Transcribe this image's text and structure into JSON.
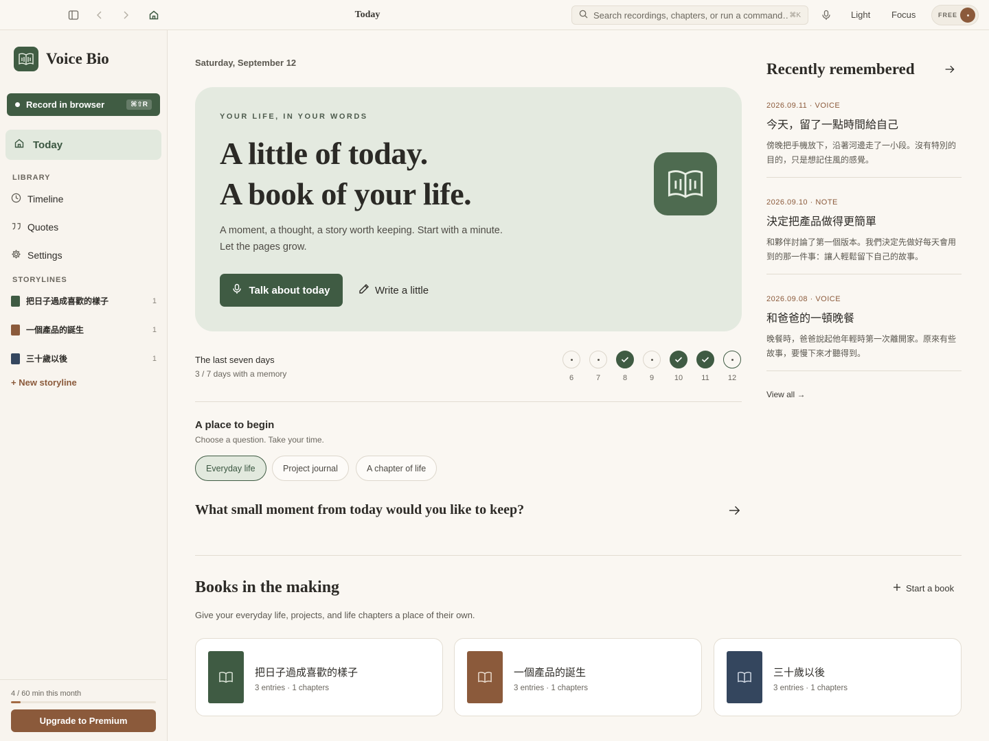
{
  "topbar": {
    "title": "Today",
    "search_placeholder": "Search recordings, chapters, or run a command…",
    "search_shortcut": "⌘K",
    "theme_label": "Light",
    "focus_label": "Focus",
    "plan_label": "FREE"
  },
  "sidebar": {
    "brand": "Voice Bio",
    "record_label": "Record in browser",
    "record_shortcut": "⌘⇧R",
    "today_label": "Today",
    "library_heading": "LIBRARY",
    "library_items": [
      {
        "label": "Timeline",
        "icon": "clock-icon"
      },
      {
        "label": "Quotes",
        "icon": "quote-icon"
      },
      {
        "label": "Settings",
        "icon": "gear-icon"
      }
    ],
    "storylines_heading": "STORYLINES",
    "storylines": [
      {
        "label": "把日子過成喜歡的樣子",
        "count": "1",
        "color": "#3f5b43"
      },
      {
        "label": "一個產品的誕生",
        "count": "1",
        "color": "#8b5a3b"
      },
      {
        "label": "三十歲以後",
        "count": "1",
        "color": "#34465e"
      }
    ],
    "new_storyline_label": "+ New storyline",
    "usage_label": "4 / 60 min this month",
    "usage_fraction": 0.067,
    "upgrade_label": "Upgrade to Premium"
  },
  "main": {
    "date": "Saturday, September 12",
    "hero": {
      "eyebrow": "YOUR LIFE, IN YOUR WORDS",
      "headline_1": "A little of today.",
      "headline_2": "A book of your life.",
      "sub_1": "A moment, a thought, a story worth keeping. Start with a minute.",
      "sub_2": "Let the pages grow.",
      "talk_label": "Talk about today",
      "write_label": "Write a little"
    },
    "week": {
      "title": "The last seven days",
      "summary": "3 / 7 days with a memory",
      "days": [
        {
          "n": "6",
          "state": "empty"
        },
        {
          "n": "7",
          "state": "empty"
        },
        {
          "n": "8",
          "state": "done"
        },
        {
          "n": "9",
          "state": "empty"
        },
        {
          "n": "10",
          "state": "done"
        },
        {
          "n": "11",
          "state": "done"
        },
        {
          "n": "12",
          "state": "today"
        }
      ]
    },
    "begin": {
      "title": "A place to begin",
      "subtitle": "Choose a question. Take your time.",
      "chips": [
        "Everyday life",
        "Project journal",
        "A chapter of life"
      ],
      "selected_chip": "Everyday life",
      "prompt": "What small moment from today would you like to keep?"
    },
    "books": {
      "title": "Books in the making",
      "subtitle": "Give your everyday life, projects, and life chapters a place of their own.",
      "start_label": "Start a book",
      "items": [
        {
          "title": "把日子過成喜歡的樣子",
          "meta": "3 entries · 1 chapters",
          "color": "#3f5b43"
        },
        {
          "title": "一個產品的誕生",
          "meta": "3 entries · 1 chapters",
          "color": "#8b5a3b"
        },
        {
          "title": "三十歲以後",
          "meta": "3 entries · 1 chapters",
          "color": "#34465e"
        }
      ]
    }
  },
  "recent": {
    "title": "Recently remembered",
    "items": [
      {
        "meta": "2026.09.11 · VOICE",
        "title": "今天，留了一點時間給自己",
        "body_1": "傍晚把手機放下，沿著河邊走了一小段。沒有特別的",
        "body_2": "目的，只是想記住風的感覺。"
      },
      {
        "meta": "2026.09.10 · NOTE",
        "title": "決定把產品做得更簡單",
        "body_1": "和夥伴討論了第一個版本。我們決定先做好每天會用",
        "body_2": "到的那一件事：讓人輕鬆留下自己的故事。"
      },
      {
        "meta": "2026.09.08 · VOICE",
        "title": "和爸爸的一頓晚餐",
        "body_1": "晚餐時，爸爸說起他年輕時第一次離開家。原來有些",
        "body_2": "故事，要慢下來才聽得到。"
      }
    ],
    "view_all_label": "View all →"
  }
}
